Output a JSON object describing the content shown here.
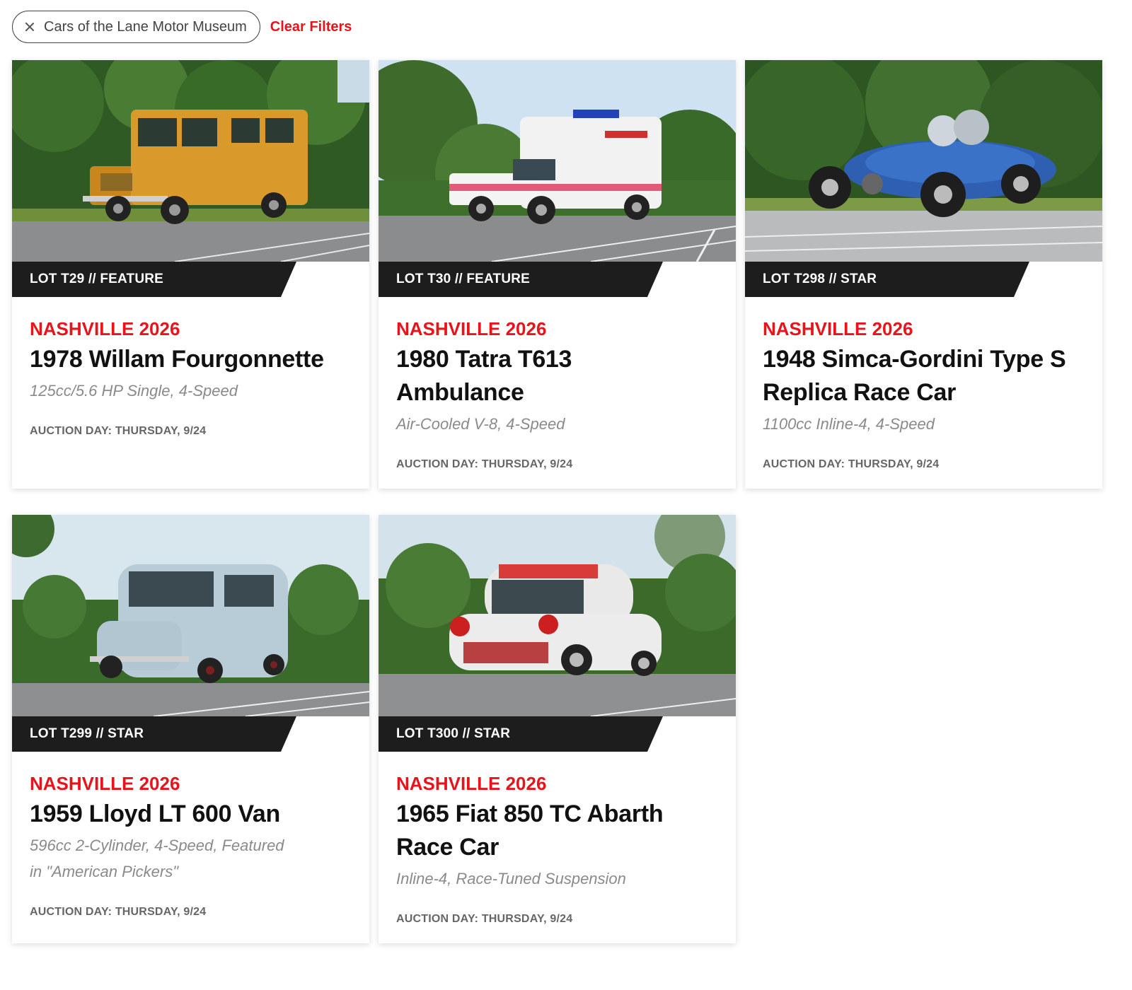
{
  "filter": {
    "chip_label": "Cars of the Lane Motor Museum",
    "clear_label": "Clear Filters"
  },
  "colors": {
    "accent_red": "#e8141b",
    "band_dark": "#1d1d1d",
    "subtitle_gray": "#8a8a8a"
  },
  "cards": [
    {
      "lot": "LOT T29 // FEATURE",
      "sale": "NASHVILLE 2026",
      "title": "1978 Willam Fourgonnette",
      "subtitle": "125cc/5.6 HP Single, 4-Speed",
      "auction_day": "AUCTION DAY: THURSDAY, 9/24",
      "photo": "orange-utility-van"
    },
    {
      "lot": "LOT T30 // FEATURE",
      "sale": "NASHVILLE 2026",
      "title": "1980 Tatra T613 Ambulance",
      "subtitle": "Air-Cooled V-8, 4-Speed",
      "auction_day": "AUCTION DAY: THURSDAY, 9/24",
      "photo": "white-ambulance"
    },
    {
      "lot": "LOT T298 // STAR",
      "sale": "NASHVILLE 2026",
      "title": "1948 Simca-Gordini Type S Replica Race Car",
      "subtitle": "1100cc Inline-4, 4-Speed",
      "auction_day": "AUCTION DAY: THURSDAY, 9/24",
      "photo": "blue-race-car"
    },
    {
      "lot": "LOT T299 // STAR",
      "sale": "NASHVILLE 2026",
      "title": "1959 Lloyd LT 600 Van",
      "subtitle": "596cc 2-Cylinder, 4-Speed, Featured in \"American Pickers\"",
      "auction_day": "AUCTION DAY: THURSDAY, 9/24",
      "photo": "light-blue-van"
    },
    {
      "lot": "LOT T300 // STAR",
      "sale": "NASHVILLE 2026",
      "title": "1965 Fiat 850 TC Abarth Race Car",
      "subtitle": "Inline-4, Race-Tuned Suspension",
      "auction_day": "AUCTION DAY: THURSDAY, 9/24",
      "photo": "white-red-fiat"
    }
  ]
}
